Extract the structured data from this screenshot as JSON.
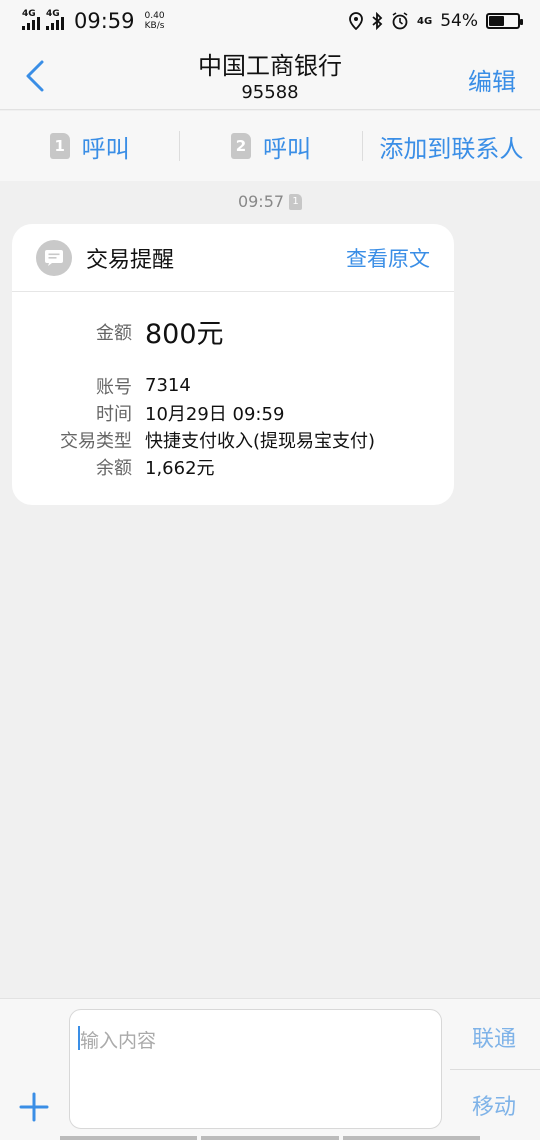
{
  "status_bar": {
    "network_1": "4G",
    "network_2": "4G",
    "time": "09:59",
    "speed_value": "0.40",
    "speed_unit": "KB/s",
    "network_3": "4G",
    "battery": "54%",
    "battery_level": 0.54
  },
  "header": {
    "title": "中国工商银行",
    "subtitle": "95588",
    "edit_label": "编辑"
  },
  "actions": {
    "sim1_number": "1",
    "sim1_label": "呼叫",
    "sim2_number": "2",
    "sim2_label": "呼叫",
    "add_contact_label": "添加到联系人"
  },
  "message": {
    "timestamp": "09:57",
    "sim_number": "1",
    "card_title": "交易提醒",
    "view_original": "查看原文",
    "amount_label": "金额",
    "amount_value": "800元",
    "rows": [
      {
        "label": "账号",
        "value": "7314"
      },
      {
        "label": "时间",
        "value": "10月29日 09:59"
      },
      {
        "label": "交易类型",
        "value": "快捷支付收入(提现易宝支付)"
      },
      {
        "label": "余额",
        "value": "1,662元"
      }
    ]
  },
  "composer": {
    "placeholder": "输入内容",
    "carrier_1": "联通",
    "carrier_2": "移动"
  },
  "colors": {
    "accent": "#3a8ee6",
    "background": "#f0f0f0"
  }
}
